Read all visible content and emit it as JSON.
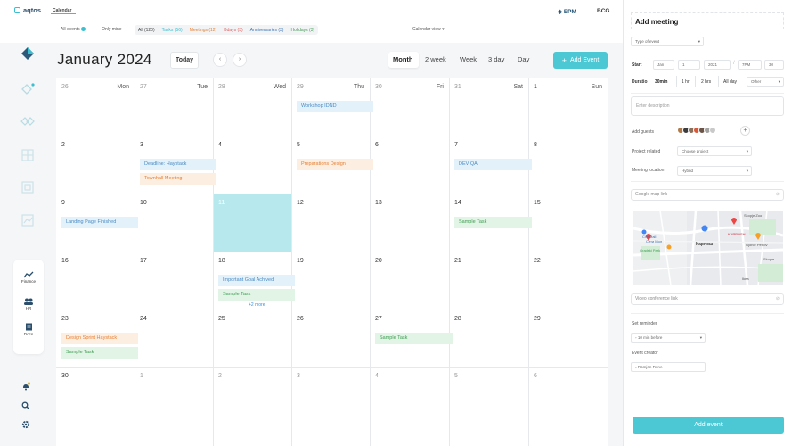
{
  "app": {
    "logo": "aqtos",
    "section_title": "Calendar",
    "orgs": [
      "EPM",
      "BCG"
    ]
  },
  "filters": {
    "all_events": "All events",
    "only_mine": "Only mine",
    "chips": [
      {
        "label": "All (120)",
        "color": "#444444"
      },
      {
        "label": "Tasks (56)",
        "color": "#3bbfd0"
      },
      {
        "label": "Meetings (12)",
        "color": "#e68033"
      },
      {
        "label": "Bdays (3)",
        "color": "#e05b5b"
      },
      {
        "label": "Anniversaries (3)",
        "color": "#3b74b8"
      },
      {
        "label": "Holidays (3)",
        "color": "#3e9d52"
      }
    ],
    "calendar_view": "Calendar view"
  },
  "sidebar": {
    "items": [
      {
        "label": "Finance"
      },
      {
        "label": "HR"
      },
      {
        "label": "Docs"
      }
    ]
  },
  "calendar": {
    "month_title": "January 2024",
    "today_label": "Today",
    "prev": "‹",
    "next": "›",
    "views": [
      "Month",
      "2 week",
      "Week",
      "3 day",
      "Day"
    ],
    "add_event": "Add Event",
    "weekdays": [
      "Mon",
      "Tue",
      "Wed",
      "Thu",
      "Fri",
      "Sat",
      "Sun"
    ],
    "weeks": [
      [
        "26",
        "27",
        "28",
        "29",
        "30",
        "31",
        "1"
      ],
      [
        "2",
        "3",
        "4",
        "5",
        "6",
        "7",
        "8"
      ],
      [
        "9",
        "10",
        "11",
        "12",
        "13",
        "14",
        "15"
      ],
      [
        "16",
        "17",
        "18",
        "19",
        "20",
        "21",
        "22"
      ],
      [
        "23",
        "24",
        "25",
        "26",
        "27",
        "28",
        "29"
      ],
      [
        "30",
        "1",
        "2",
        "3",
        "4",
        "5",
        "6"
      ]
    ],
    "events": [
      {
        "week": 0,
        "day": 3,
        "slot": 0,
        "label": "Workshop IDND",
        "kind": "blue"
      },
      {
        "week": 1,
        "day": 1,
        "slot": 0,
        "label": "Deadline: Haystack",
        "kind": "blue"
      },
      {
        "week": 1,
        "day": 1,
        "slot": 1,
        "label": "Townhall Meeting",
        "kind": "orange"
      },
      {
        "week": 1,
        "day": 3,
        "slot": 0,
        "label": "Preparations Design",
        "kind": "orange"
      },
      {
        "week": 1,
        "day": 5,
        "slot": 0,
        "label": "DEV QA",
        "kind": "blue"
      },
      {
        "week": 2,
        "day": 0,
        "slot": 0,
        "label": "Landing Page Finished",
        "kind": "blue"
      },
      {
        "week": 2,
        "day": 5,
        "slot": 0,
        "label": "Sample Task",
        "kind": "green"
      },
      {
        "week": 3,
        "day": 2,
        "slot": 0,
        "label": "Important Goal Achived",
        "kind": "blue"
      },
      {
        "week": 3,
        "day": 2,
        "slot": 1,
        "label": "Sample Task",
        "kind": "green"
      },
      {
        "week": 4,
        "day": 0,
        "slot": 0,
        "label": "Design Sprint Haystack",
        "kind": "orange"
      },
      {
        "week": 4,
        "day": 0,
        "slot": 1,
        "label": "Sample Task",
        "kind": "green"
      },
      {
        "week": 4,
        "day": 4,
        "slot": 0,
        "label": "Sample Task",
        "kind": "green"
      }
    ],
    "more_label": "+2 more"
  },
  "panel": {
    "title": "Add meeting",
    "type_of_event": "Type of event",
    "start_label": "Start",
    "start": {
      "month": "Jan",
      "day": "1",
      "year": "2021",
      "hour": "7PM",
      "minute": "30"
    },
    "duration_label": "Duratio",
    "durations": [
      "30min",
      "1 hr",
      "2 hrs",
      "All day",
      "Other"
    ],
    "description_placeholder": "Enter description",
    "guests_label": "Add guests",
    "project_label": "Project related",
    "project_value": "Choose project",
    "location_label": "Meeting location",
    "location_value": "Hybrid",
    "map_link": "Google map link",
    "map_labels": [
      "Skopje Zoo",
      "City Mall",
      "Gradski Park",
      "KARPOSH",
      "Сити Мол",
      "Карпош",
      "Gjorce Petrov",
      "Skopje",
      "Ikea"
    ],
    "video_link": "Video conference link",
    "reminder_label": "Set reminder",
    "reminder_value": "10 min before",
    "creator_label": "Event creator",
    "creator_value": "Damjan Dano",
    "submit": "Add event"
  }
}
